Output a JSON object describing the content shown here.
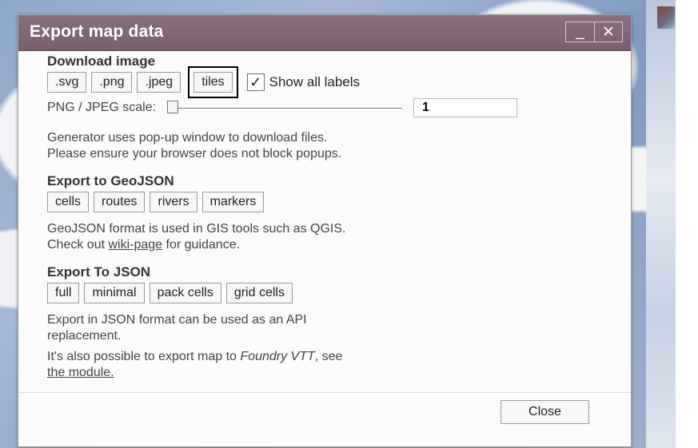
{
  "dialog": {
    "title": "Export map data",
    "controls": {
      "minimize": "_",
      "close": "✕"
    }
  },
  "download_image": {
    "heading": "Download image",
    "buttons": [
      ".svg",
      ".png",
      ".jpeg",
      "tiles"
    ],
    "show_all_labels": {
      "label": "Show all labels",
      "checked": true
    },
    "scale": {
      "label": "PNG / JPEG scale:",
      "value": "1",
      "slider_level": 0.0
    }
  },
  "generator_note": {
    "line1": "Generator uses pop-up window to download files.",
    "line2": "Please ensure your browser does not block popups."
  },
  "geojson": {
    "heading": "Export to GeoJSON",
    "buttons": [
      "cells",
      "routes",
      "rivers",
      "markers"
    ],
    "note_line1": "GeoJSON format is used in GIS tools such as QGIS.",
    "note_line2_prefix": "Check out ",
    "note_link": "wiki-page",
    "note_line2_suffix": " for guidance."
  },
  "json": {
    "heading": "Export To JSON",
    "buttons": [
      "full",
      "minimal",
      "pack cells",
      "grid cells"
    ],
    "note_line1": "Export in JSON format can be used as an API",
    "note_line2": "replacement."
  },
  "foundry": {
    "prefix": "It's also possible to export map to ",
    "italic": "Foundry VTT",
    "suffix": ", see",
    "link": "the module."
  },
  "footer": {
    "close_label": "Close"
  },
  "colors": {
    "titlebar": "#8b6f7f",
    "title_text": "#ffffff"
  }
}
